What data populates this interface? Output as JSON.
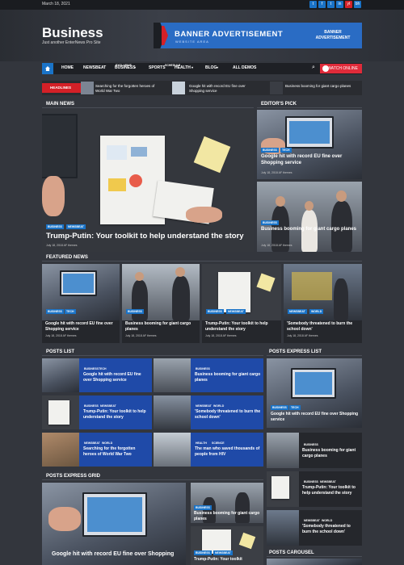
{
  "topbar": {
    "date": "March 18, 2021",
    "social": [
      "t",
      "f",
      "t",
      "in",
      "yt",
      "bh"
    ]
  },
  "header": {
    "brand": "Business",
    "tagline": "Just another EnterNews Pro Site"
  },
  "banner": {
    "title": "BANNER ADVERTISEMENT",
    "subtitle": "WEBSITE AREA",
    "right": "BANNER ADVERTISEMENT"
  },
  "nav": {
    "items": [
      "HOME",
      "NEWSBEAT",
      "BUSINESS",
      "SPORTS",
      "HEALTH",
      "BLOG",
      "ALL DEMOS"
    ],
    "badges": [
      "EXCLUSIVE",
      "SCHEDULE"
    ],
    "watch": "WATCH ONLINE"
  },
  "headlines": {
    "label": "HEADLINES",
    "items": [
      "Searching for the forgotten heroes of World War Two",
      "Google hit with record EU fine over Shopping service",
      "Business booming for giant cargo planes"
    ]
  },
  "sections": {
    "main": "MAIN NEWS",
    "editors": "EDITOR'S PICK",
    "featured": "FEATURED NEWS",
    "posts_list": "POSTS LIST",
    "posts_express": "POSTS EXPRESS LIST",
    "express_grid": "POSTS EXPRESS GRID",
    "carousel": "POSTS CAROUSEL"
  },
  "main_news": {
    "cats": [
      "BUSINESS",
      "NEWSBEAT"
    ],
    "title": "Trump-Putin: Your toolkit to help understand the story",
    "meta": "July 18, 2018  AF themes"
  },
  "editors": [
    {
      "cats": [
        "BUSINESS",
        "TECH"
      ],
      "title": "Google hit with record EU fine over Shopping service",
      "meta": "July 18, 2018  AF themes"
    },
    {
      "cats": [
        "BUSINESS"
      ],
      "title": "Business booming for giant cargo planes",
      "meta": "July 18, 2018  AF themes"
    }
  ],
  "featured": [
    {
      "cats": [
        "BUSINESS",
        "TECH"
      ],
      "title": "Google hit with record EU fine over Shopping service",
      "meta": "July 18, 2018  AF themes"
    },
    {
      "cats": [
        "BUSINESS"
      ],
      "title": "Business booming for giant cargo planes",
      "meta": "July 18, 2018  AF themes"
    },
    {
      "cats": [
        "BUSINESS",
        "NEWSBEAT"
      ],
      "title": "Trump-Putin: Your toolkit to help understand the story",
      "meta": "July 18, 2018  AF themes"
    },
    {
      "cats": [
        "NEWSBEAT",
        "WORLD"
      ],
      "title": "'Somebody threatened to burn the school down'",
      "meta": "July 18, 2018  AF themes"
    }
  ],
  "posts_list": [
    {
      "cats": [
        "BUSINESS",
        "TECH"
      ],
      "title": "Google hit with record EU fine over Shopping service"
    },
    {
      "cats": [
        "BUSINESS"
      ],
      "title": "Business booming for giant cargo planes"
    },
    {
      "cats": [
        "BUSINESS",
        "NEWSBEAT"
      ],
      "title": "Trump-Putin: Your toolkit to help understand the story"
    },
    {
      "cats": [
        "NEWSBEAT",
        "WORLD"
      ],
      "title": "'Somebody threatened to burn the school down'"
    },
    {
      "cats": [
        "NEWSBEAT",
        "WORLD"
      ],
      "title": "Searching for the forgotten heroes of World War Two"
    },
    {
      "cats": [
        "HEALTH",
        "SCIENCE"
      ],
      "title": "The man who saved thousands of people from HIV"
    }
  ],
  "express": {
    "big": {
      "cats": [
        "BUSINESS",
        "TECH"
      ],
      "title": "Google hit with record EU fine over Shopping service"
    },
    "items": [
      {
        "cats": [
          "BUSINESS"
        ],
        "title": "Business booming for giant cargo planes"
      },
      {
        "cats": [
          "BUSINESS",
          "NEWSBEAT"
        ],
        "title": "Trump-Putin: Your toolkit to help understand the story"
      },
      {
        "cats": [
          "NEWSBEAT",
          "WORLD"
        ],
        "title": "'Somebody threatened to burn the school down'"
      }
    ]
  },
  "grid": {
    "big": {
      "title": "Google hit with record EU fine over Shopping"
    },
    "items": [
      {
        "cats": [
          "BUSINESS"
        ],
        "title": "Business booming for giant cargo planes"
      },
      {
        "cats": [
          "BUSINESS",
          "NEWSBEAT"
        ],
        "title": "Trump-Putin: Your toolkit"
      }
    ]
  },
  "colors": {
    "accent": "#1a73c7",
    "red": "#d42027",
    "blue_card": "#1f4aa8",
    "bg": "#33363d"
  }
}
